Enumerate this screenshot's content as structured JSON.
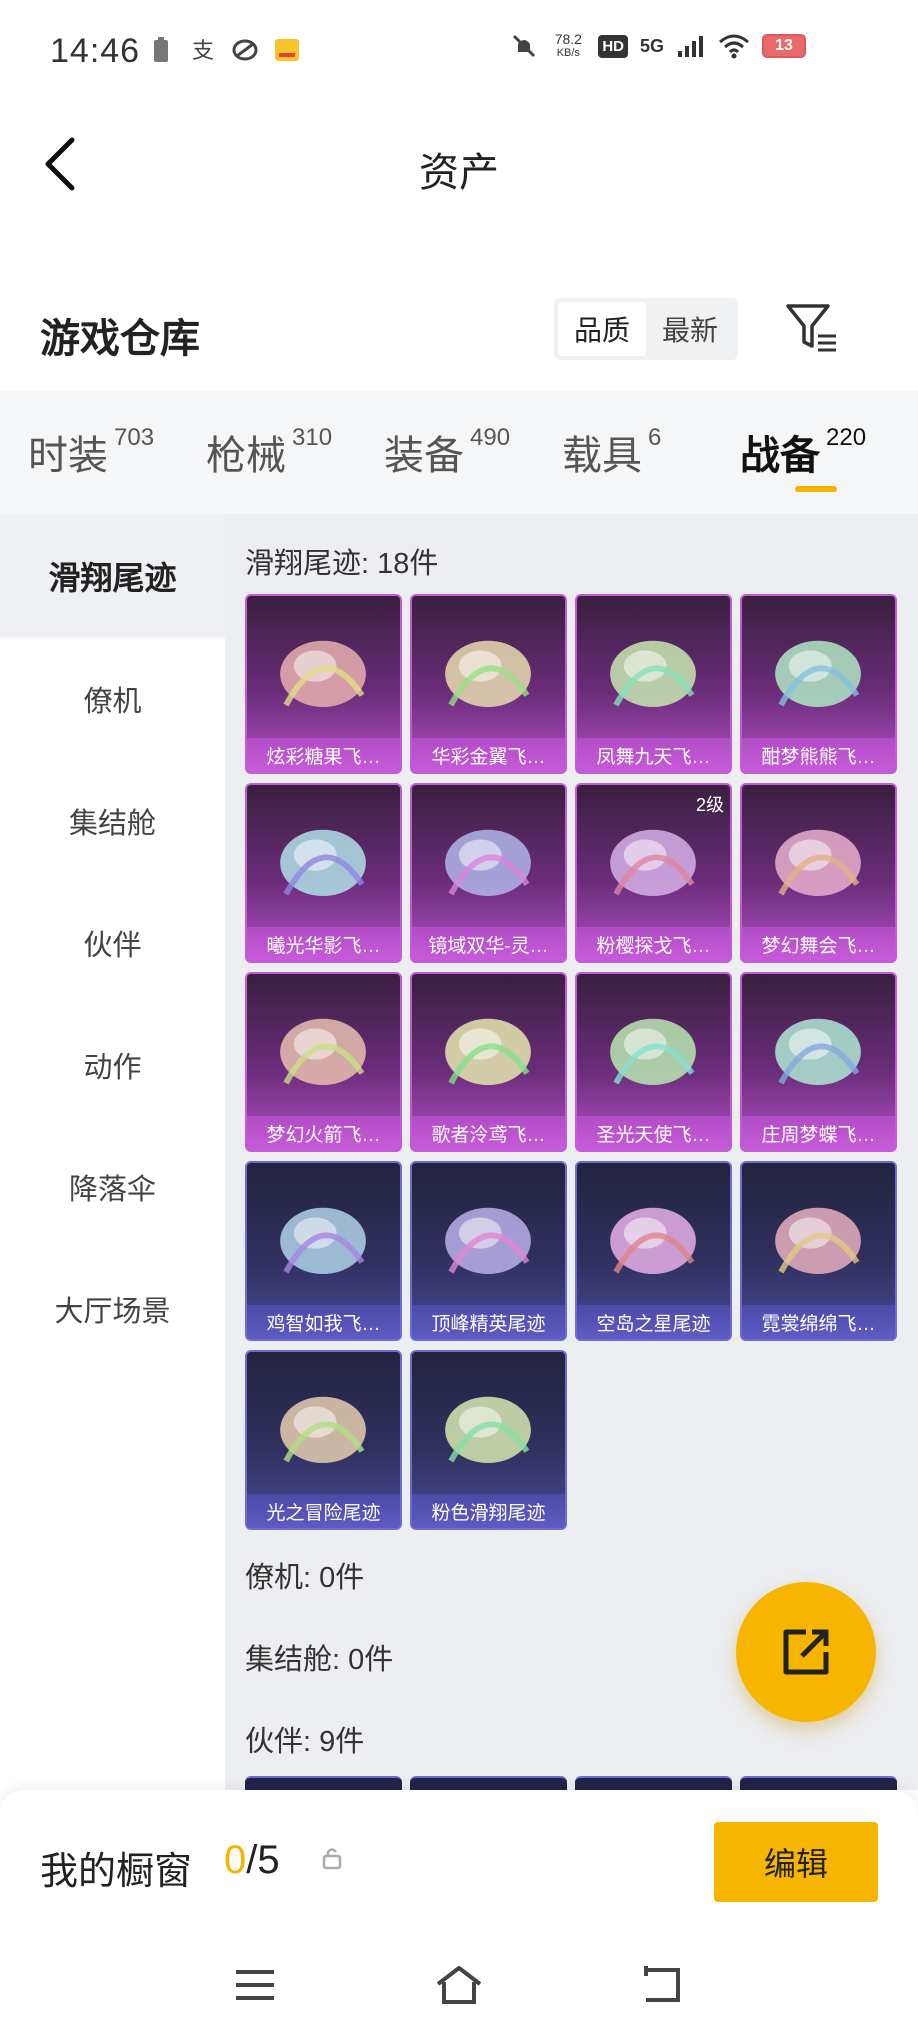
{
  "status_bar": {
    "time": "14:46",
    "net_speed_value": "78.2",
    "net_speed_unit": "KB/s",
    "hd": "HD",
    "network": "5G",
    "battery": "13",
    "icons": [
      "battery-small-icon",
      "alipay-icon",
      "app-icon",
      "news-app-icon",
      "mute-icon",
      "signal-icon",
      "wifi-icon"
    ]
  },
  "header": {
    "title": "资产"
  },
  "section": {
    "title": "游戏仓库",
    "sort_options": [
      "品质",
      "最新"
    ],
    "sort_selected": "品质"
  },
  "tabs": [
    {
      "label": "时装",
      "count": "703"
    },
    {
      "label": "枪械",
      "count": "310"
    },
    {
      "label": "装备",
      "count": "490"
    },
    {
      "label": "载具",
      "count": "6"
    },
    {
      "label": "战备",
      "count": "220",
      "active": true
    }
  ],
  "side_nav": [
    "滑翔尾迹",
    "僚机",
    "集结舱",
    "伙伴",
    "动作",
    "降落伞",
    "大厅场景"
  ],
  "groups": {
    "glide_trail": "滑翔尾迹: 18件",
    "wingman": "僚机: 0件",
    "pod": "集结舱: 0件",
    "partner": "伙伴: 9件"
  },
  "items": [
    {
      "name": "炫彩糖果飞…",
      "rarity": "purple"
    },
    {
      "name": "华彩金翼飞…",
      "rarity": "purple"
    },
    {
      "name": "凤舞九天飞…",
      "rarity": "purple"
    },
    {
      "name": "酣梦熊熊飞…",
      "rarity": "purple"
    },
    {
      "name": "曦光华影飞…",
      "rarity": "purple"
    },
    {
      "name": "镜域双华-灵…",
      "rarity": "purple"
    },
    {
      "name": "粉樱探戈飞…",
      "rarity": "purple",
      "badge": "2级"
    },
    {
      "name": "梦幻舞会飞…",
      "rarity": "purple"
    },
    {
      "name": "梦幻火箭飞…",
      "rarity": "purple"
    },
    {
      "name": "歌者泠鸢飞…",
      "rarity": "purple"
    },
    {
      "name": "圣光天使飞…",
      "rarity": "purple"
    },
    {
      "name": "庄周梦蝶飞…",
      "rarity": "purple"
    },
    {
      "name": "鸡智如我飞…",
      "rarity": "blue"
    },
    {
      "name": "顶峰精英尾迹",
      "rarity": "blue"
    },
    {
      "name": "空岛之星尾迹",
      "rarity": "blue"
    },
    {
      "name": "霓裳绵绵飞…",
      "rarity": "blue"
    },
    {
      "name": "光之冒险尾迹",
      "rarity": "blue"
    },
    {
      "name": "粉色滑翔尾迹",
      "rarity": "blue"
    }
  ],
  "showcase": {
    "title": "我的橱窗",
    "used": "0",
    "total": "/5",
    "edit_label": "编辑"
  },
  "colors": {
    "accent": "#f7b500",
    "purple_card": "#b54fc6",
    "blue_card": "#4b4a9a"
  }
}
